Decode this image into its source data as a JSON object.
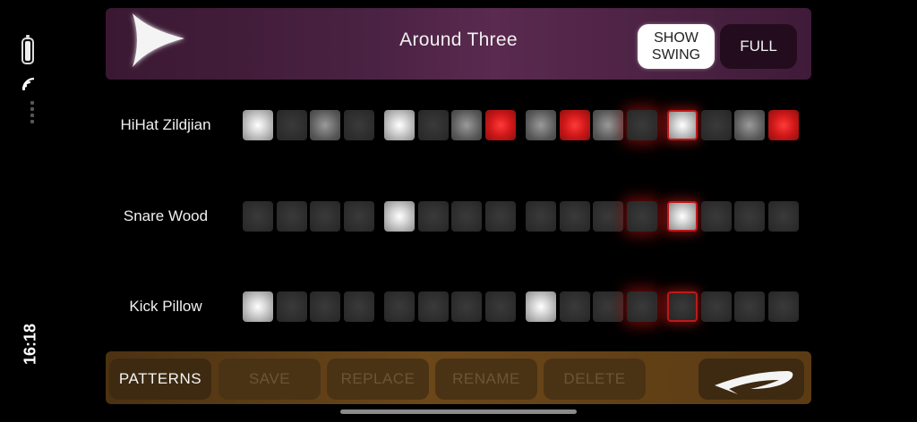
{
  "status": {
    "time": "16:18",
    "battery_icon": "battery-icon",
    "wifi_icon": "wifi-icon"
  },
  "header": {
    "title": "Around Three",
    "play_icon": "play-icon",
    "show_swing_label": "SHOW\nSWING",
    "full_label": "FULL"
  },
  "tracks": [
    {
      "name": "HiHat Zildjian",
      "steps": [
        "bright",
        "dim",
        "mid",
        "dim",
        "bright",
        "dim",
        "mid",
        "red",
        "mid",
        "red",
        "mid",
        "dim",
        "bright",
        "dim",
        "mid",
        "red"
      ]
    },
    {
      "name": "Snare Wood",
      "steps": [
        "dim",
        "dim",
        "dim",
        "dim",
        "bright",
        "dim",
        "dim",
        "dim",
        "dim",
        "dim",
        "dim",
        "dim",
        "bright",
        "dim",
        "dim",
        "dim"
      ]
    },
    {
      "name": "Kick Pillow",
      "steps": [
        "bright",
        "dim",
        "dim",
        "dim",
        "dim",
        "dim",
        "dim",
        "dim",
        "bright",
        "dim",
        "dim",
        "dim",
        "dim",
        "dim",
        "dim",
        "dim"
      ]
    }
  ],
  "playhead_step": 11,
  "current_step": 12,
  "toolbar": {
    "patterns_label": "PATTERNS",
    "save_label": "SAVE",
    "replace_label": "REPLACE",
    "rename_label": "RENAME",
    "delete_label": "DELETE",
    "back_icon": "swoosh-arrow-left-icon"
  },
  "colors": {
    "header_purple": "#4a2243",
    "toolbar_brown": "#6b4719",
    "step_active_red": "#e02020"
  }
}
